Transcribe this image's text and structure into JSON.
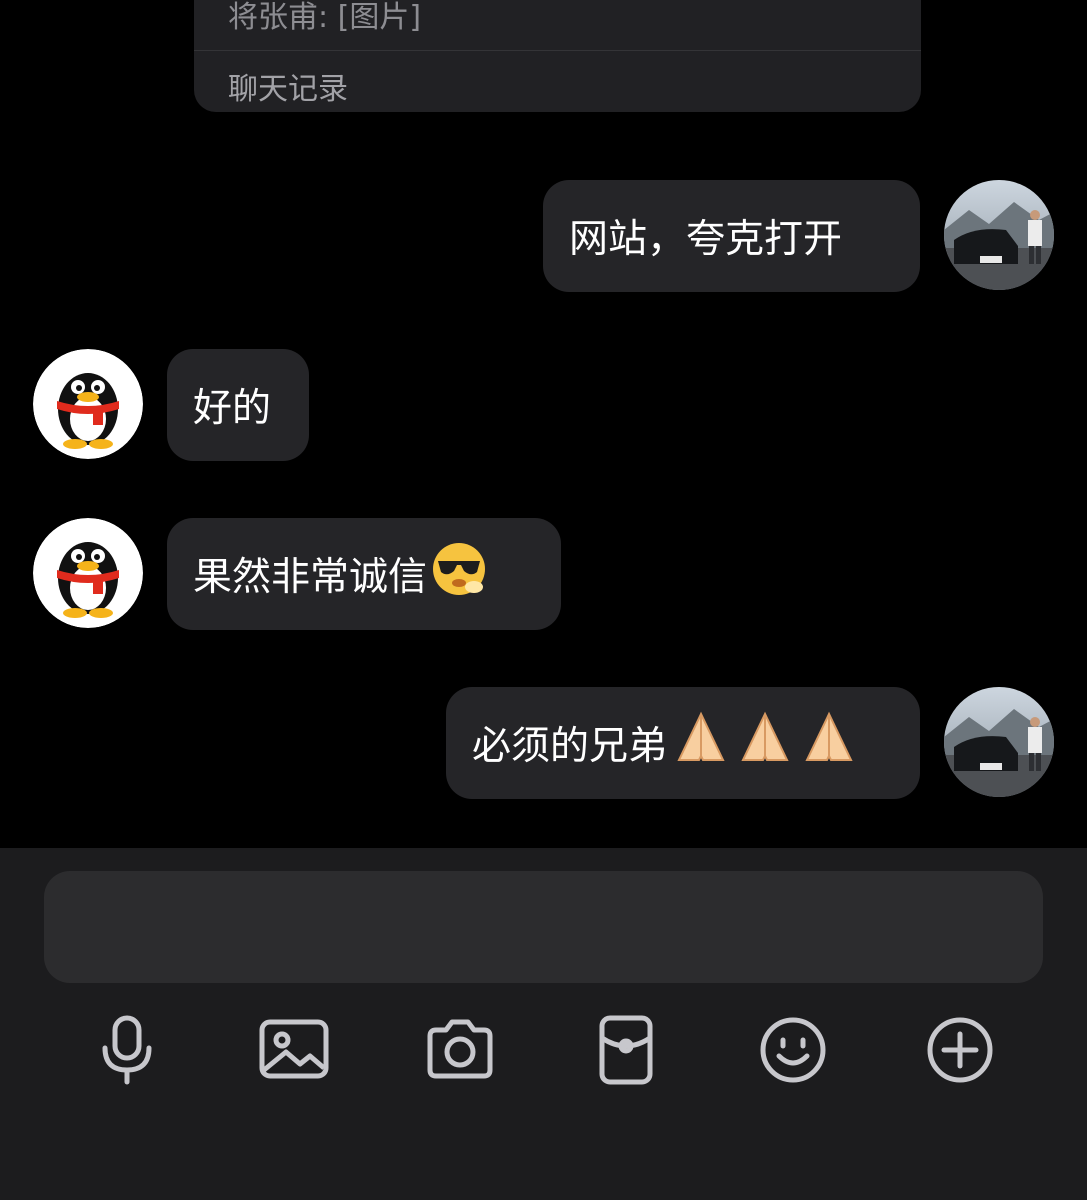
{
  "forwarded_card": {
    "preview": "将张甫: [图片]",
    "footer_label": "聊天记录"
  },
  "messages": [
    {
      "side": "right",
      "sender": "self",
      "text": "网站，夸克打开",
      "emoji": []
    },
    {
      "side": "left",
      "sender": "contact",
      "text": "好的",
      "emoji": []
    },
    {
      "side": "left",
      "sender": "contact",
      "text": "果然非常诚信",
      "emoji": [
        "sunglasses-face"
      ]
    },
    {
      "side": "right",
      "sender": "self",
      "text": "必须的兄弟",
      "emoji": [
        "pray-hands",
        "pray-hands",
        "pray-hands"
      ]
    }
  ],
  "input": {
    "value": ""
  },
  "toolbar": [
    "microphone-icon",
    "image-icon",
    "camera-icon",
    "red-packet-icon",
    "emoji-icon",
    "plus-icon"
  ],
  "colors": {
    "background": "#000000",
    "bubble": "#252528",
    "panel": "#1c1c1e",
    "input": "#2c2c2e",
    "icon": "#c7c7cc"
  }
}
